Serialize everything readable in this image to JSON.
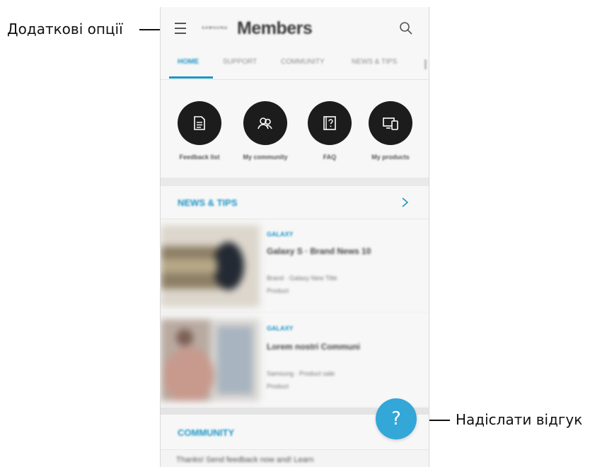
{
  "callouts": {
    "menu_label": "Додаткові опції",
    "feedback_label": "Надіслати відгук"
  },
  "app": {
    "brand_small": "SAMSUNG",
    "brand": "Members"
  },
  "tabs": [
    {
      "label": "HOME",
      "active": true
    },
    {
      "label": "SUPPORT"
    },
    {
      "label": "COMMUNITY"
    },
    {
      "label": "NEWS & TIPS"
    }
  ],
  "quick_actions": [
    {
      "label": "Feedback list",
      "icon": "document-icon"
    },
    {
      "label": "My community",
      "icon": "people-icon"
    },
    {
      "label": "FAQ",
      "icon": "faq-icon"
    },
    {
      "label": "My products",
      "icon": "devices-icon"
    }
  ],
  "news": {
    "title": "NEWS & TIPS",
    "articles": [
      {
        "tag": "GALAXY",
        "title": "Galaxy S · Brand News 10",
        "meta": "Brand · Galaxy New Title",
        "sub": "Product"
      },
      {
        "tag": "GALAXY",
        "title": "Lorem nostri Communi",
        "meta": "Samsung · Product sale",
        "sub": "Product"
      }
    ]
  },
  "community": {
    "title": "COMMUNITY",
    "preview": "Thanks! Send feedback now and! Learn"
  },
  "fab": {
    "label": "?"
  },
  "colors": {
    "accent": "#1e95c6",
    "fab": "#32a7d8",
    "icon_circle": "#1c1c1c"
  }
}
